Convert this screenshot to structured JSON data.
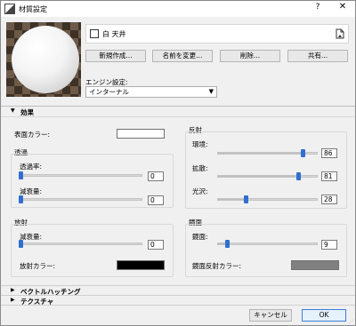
{
  "window": {
    "title": "材質設定",
    "help_glyph": "?",
    "close_glyph": "✕"
  },
  "material": {
    "name": "白 天井",
    "menu_icon": "doc-menu-icon"
  },
  "buttons": {
    "new": "新規作成...",
    "rename": "名前を変更...",
    "delete": "削除...",
    "share": "共有...",
    "cancel": "キャンセル",
    "ok": "OK"
  },
  "engine": {
    "label": "エンジン設定:",
    "value": "インターナル"
  },
  "sections": {
    "effects": "効果",
    "vector_hatch": "ベクトルハッチング",
    "texture": "テクスチャ"
  },
  "effects": {
    "surface_color_label": "表面カラー:",
    "surface_color": "#ffffff",
    "transparency": {
      "title": "透過",
      "rate_label": "透過率:",
      "rate_value": "0",
      "rate_fraction": 0,
      "attenuation_label": "減衰量:",
      "attenuation_value": "0",
      "attenuation_fraction": 0
    },
    "emission": {
      "title": "放射",
      "attenuation_label": "減衰量:",
      "attenuation_value": "0",
      "attenuation_fraction": 0,
      "color_label": "放射カラー:",
      "color": "#000000"
    },
    "reflection": {
      "title": "反射",
      "ambient_label": "環境:",
      "ambient_value": "86",
      "ambient_fraction": 0.86,
      "diffuse_label": "拡散:",
      "diffuse_value": "81",
      "diffuse_fraction": 0.81,
      "gloss_label": "光沢:",
      "gloss_value": "28",
      "gloss_fraction": 0.28
    },
    "specular": {
      "title": "鏡面",
      "specular_label": "鏡面:",
      "specular_value": "9",
      "specular_fraction": 0.09,
      "color_label": "鏡面反射カラー:",
      "color": "#808080"
    }
  }
}
